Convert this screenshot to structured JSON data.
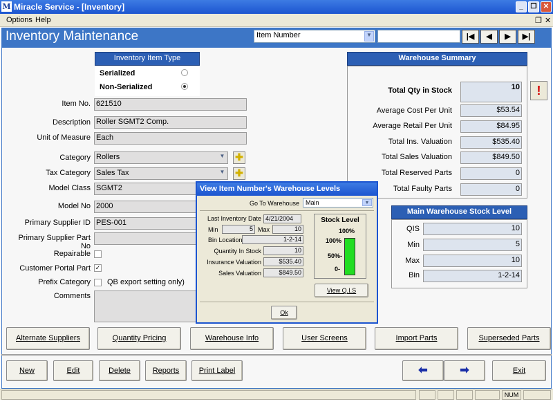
{
  "window": {
    "title": "Miracle Service - [Inventory]",
    "app_icon": "M"
  },
  "menu": {
    "options": "Options",
    "help": "Help"
  },
  "header": {
    "title": "Inventory Maintenance",
    "search_by": "Item Number",
    "search_value": ""
  },
  "nav": {
    "first": "|◀",
    "prev": "◀",
    "next": "▶",
    "last": "▶|"
  },
  "item_type": {
    "heading": "Inventory Item Type",
    "serialized": "Serialized",
    "non_serialized": "Non-Serialized"
  },
  "fields": {
    "item_no": {
      "label": "Item No.",
      "value": "621510"
    },
    "description": {
      "label": "Description",
      "value": "Roller SGMT2 Comp."
    },
    "uom": {
      "label": "Unit of Measure",
      "value": "Each"
    },
    "category": {
      "label": "Category",
      "value": "Rollers"
    },
    "tax_category": {
      "label": "Tax Category",
      "value": "Sales Tax"
    },
    "model_class": {
      "label": "Model Class",
      "value": "SGMT2"
    },
    "model_no": {
      "label": "Model No",
      "value": "2000"
    },
    "primary_supplier_id": {
      "label": "Primary Supplier ID",
      "value": "PES-001"
    },
    "primary_supplier_part": {
      "label": "Primary Supplier Part No",
      "value": ""
    },
    "repairable": {
      "label": "Repairable"
    },
    "customer_portal": {
      "label": "Customer Portal Part"
    },
    "prefix_category": {
      "label": "Prefix Category",
      "suffix": "QB export setting only)"
    },
    "comments": {
      "label": "Comments"
    }
  },
  "warehouse_summary": {
    "heading": "Warehouse Summary",
    "total_qty": {
      "label": "Total Qty in Stock",
      "value": "10"
    },
    "avg_cost": {
      "label": "Average Cost Per Unit",
      "value": "$53.54"
    },
    "avg_retail": {
      "label": "Average Retail Per Unit",
      "value": "$84.95"
    },
    "ins_val": {
      "label": "Total Ins. Valuation",
      "value": "$535.40"
    },
    "sales_val": {
      "label": "Total Sales Valuation",
      "value": "$849.50"
    },
    "reserved": {
      "label": "Total Reserved Parts",
      "value": "0"
    },
    "faulty": {
      "label": "Total Faulty Parts",
      "value": "0"
    },
    "alert": "!"
  },
  "main_stock": {
    "heading": "Main Warehouse Stock Level",
    "qis": {
      "label": "QIS",
      "value": "10"
    },
    "min": {
      "label": "Min",
      "value": "5"
    },
    "max": {
      "label": "Max",
      "value": "10"
    },
    "bin": {
      "label": "Bin",
      "value": "1-2-14"
    }
  },
  "dialog": {
    "title": "View Item Number's Warehouse Levels",
    "goto_label": "Go To Warehouse",
    "goto_value": "Main",
    "last_inv_label": "Last Inventory Date",
    "last_inv_value": "4/21/2004",
    "min_label": "Min",
    "min_value": "5",
    "max_label": "Max",
    "max_value": "10",
    "bin_label": "Bin Location",
    "bin_value": "1-2-14",
    "qis_label": "Quantity In Stock",
    "qis_value": "10",
    "ins_label": "Insurance Valuation",
    "ins_value": "$535.40",
    "sales_label": "Sales Valuation",
    "sales_value": "$849.50",
    "stock_level_heading": "Stock Level",
    "stock_pct_top": "100%",
    "scale_100": "100%",
    "scale_50": "50%-",
    "scale_0": "0-",
    "stock_fill_fraction": 1.0,
    "view_qis": "View Q.I.S",
    "ok": "Ok"
  },
  "buttons_row1": [
    "Alternate Suppliers",
    "Quantity Pricing",
    "Warehouse Info",
    "User Screens",
    "Import Parts",
    "Superseded Parts"
  ],
  "buttons_row2": {
    "new": "New",
    "edit": "Edit",
    "delete": "Delete",
    "reports": "Reports",
    "print_label": "Print Label",
    "back": "⬅",
    "forward": "➡",
    "exit": "Exit"
  },
  "status": {
    "num": "NUM"
  },
  "colors": {
    "accent": "#3d76c6",
    "stock_fill": "#22dd22"
  }
}
